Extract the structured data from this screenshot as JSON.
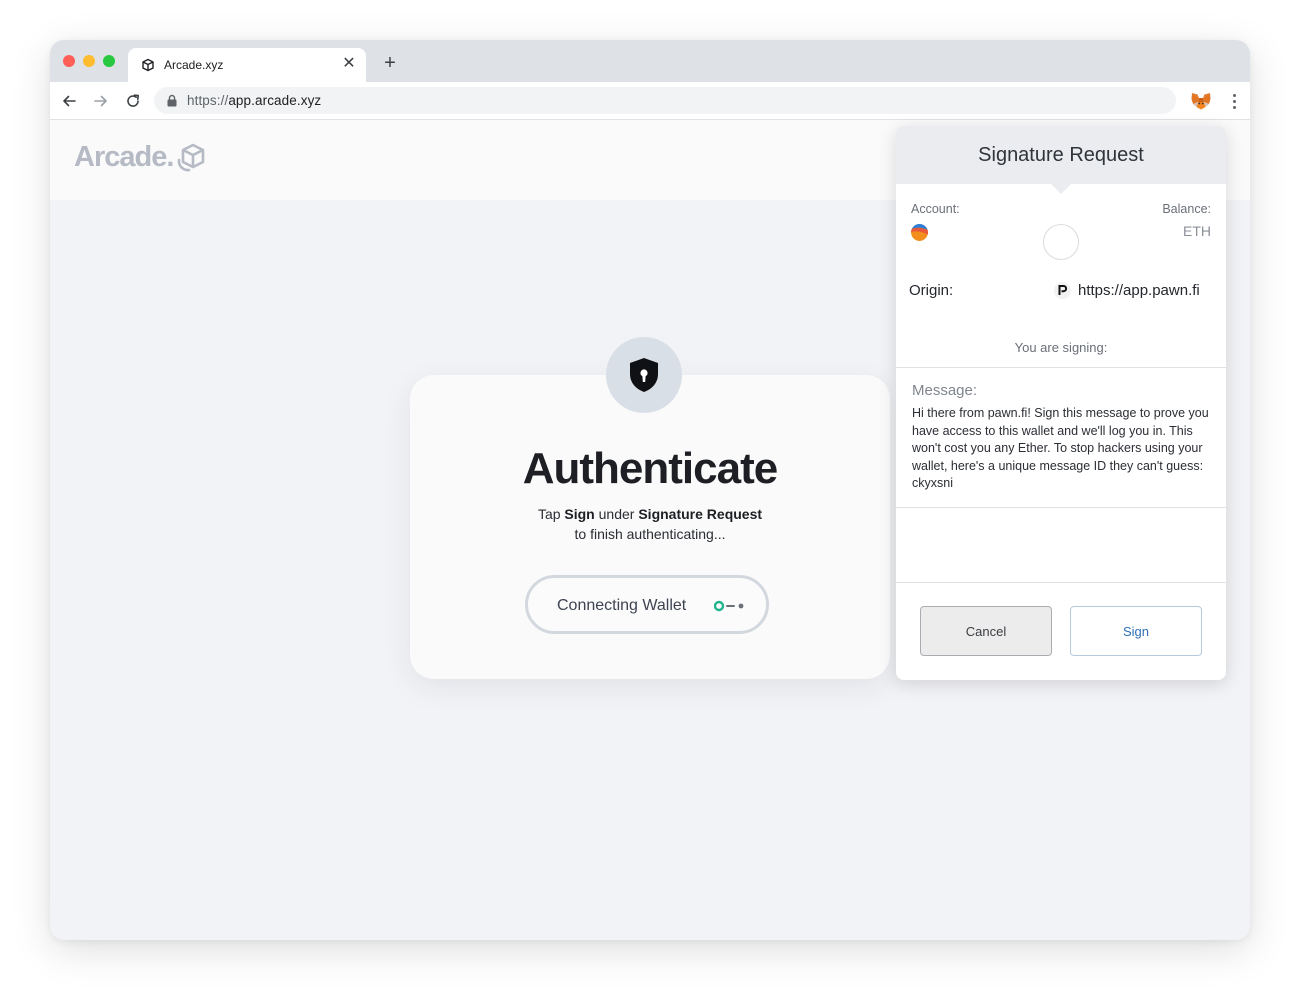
{
  "browser": {
    "tab_title": "Arcade.xyz",
    "tab_close": "✕",
    "new_tab": "+",
    "url_scheme": "https://",
    "url_host": "app.arcade.xyz"
  },
  "app": {
    "logo_text": "Arcade."
  },
  "auth": {
    "title": "Authenticate",
    "line1_prefix": "Tap ",
    "line1_sign": "Sign",
    "line1_mid": " under ",
    "line1_request": "Signature Request",
    "line2": "to finish authenticating...",
    "button_label": "Connecting Wallet",
    "icon": "shield-keyhole-icon"
  },
  "signature": {
    "title": "Signature Request",
    "account_label": "Account:",
    "balance_label": "Balance:",
    "balance_value": "ETH",
    "origin_label": "Origin:",
    "origin_url": "https://app.pawn.fi",
    "you_are_signing": "You are signing:",
    "message_label": "Message:",
    "message_text": "Hi there from pawn.fi! Sign this message to prove you have access to this wallet and we'll log you in. This won't cost you any Ether. To stop hackers using your wallet, here's a unique message ID they can't guess: ckyxsni",
    "cancel_label": "Cancel",
    "sign_label": "Sign"
  },
  "colors": {
    "accent_green": "#1fb58a",
    "sign_blue": "#2f6fb5",
    "page_bg": "#f2f3f6"
  }
}
